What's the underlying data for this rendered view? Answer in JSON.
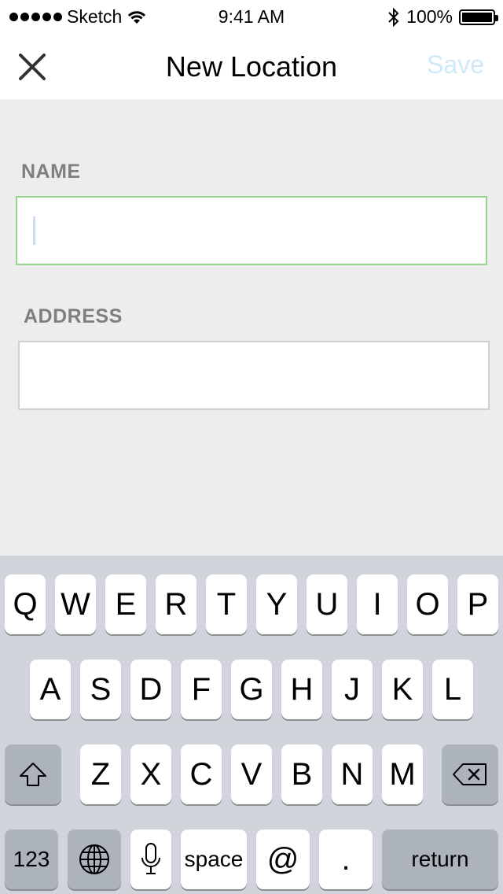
{
  "status_bar": {
    "carrier": "Sketch",
    "time": "9:41 AM",
    "battery": "100%"
  },
  "nav": {
    "title": "New Location",
    "save": "Save"
  },
  "form": {
    "name_label": "NAME",
    "name_value": "",
    "address_label": "ADDRESS",
    "address_value": ""
  },
  "keyboard": {
    "row1": [
      "Q",
      "W",
      "E",
      "R",
      "T",
      "Y",
      "U",
      "I",
      "O",
      "P"
    ],
    "row2": [
      "A",
      "S",
      "D",
      "F",
      "G",
      "H",
      "J",
      "K",
      "L"
    ],
    "row3": [
      "Z",
      "X",
      "C",
      "V",
      "B",
      "N",
      "M"
    ],
    "numbers_key": "123",
    "space_key": "space",
    "at_key": "@",
    "period_key": ".",
    "return_key": "return"
  }
}
